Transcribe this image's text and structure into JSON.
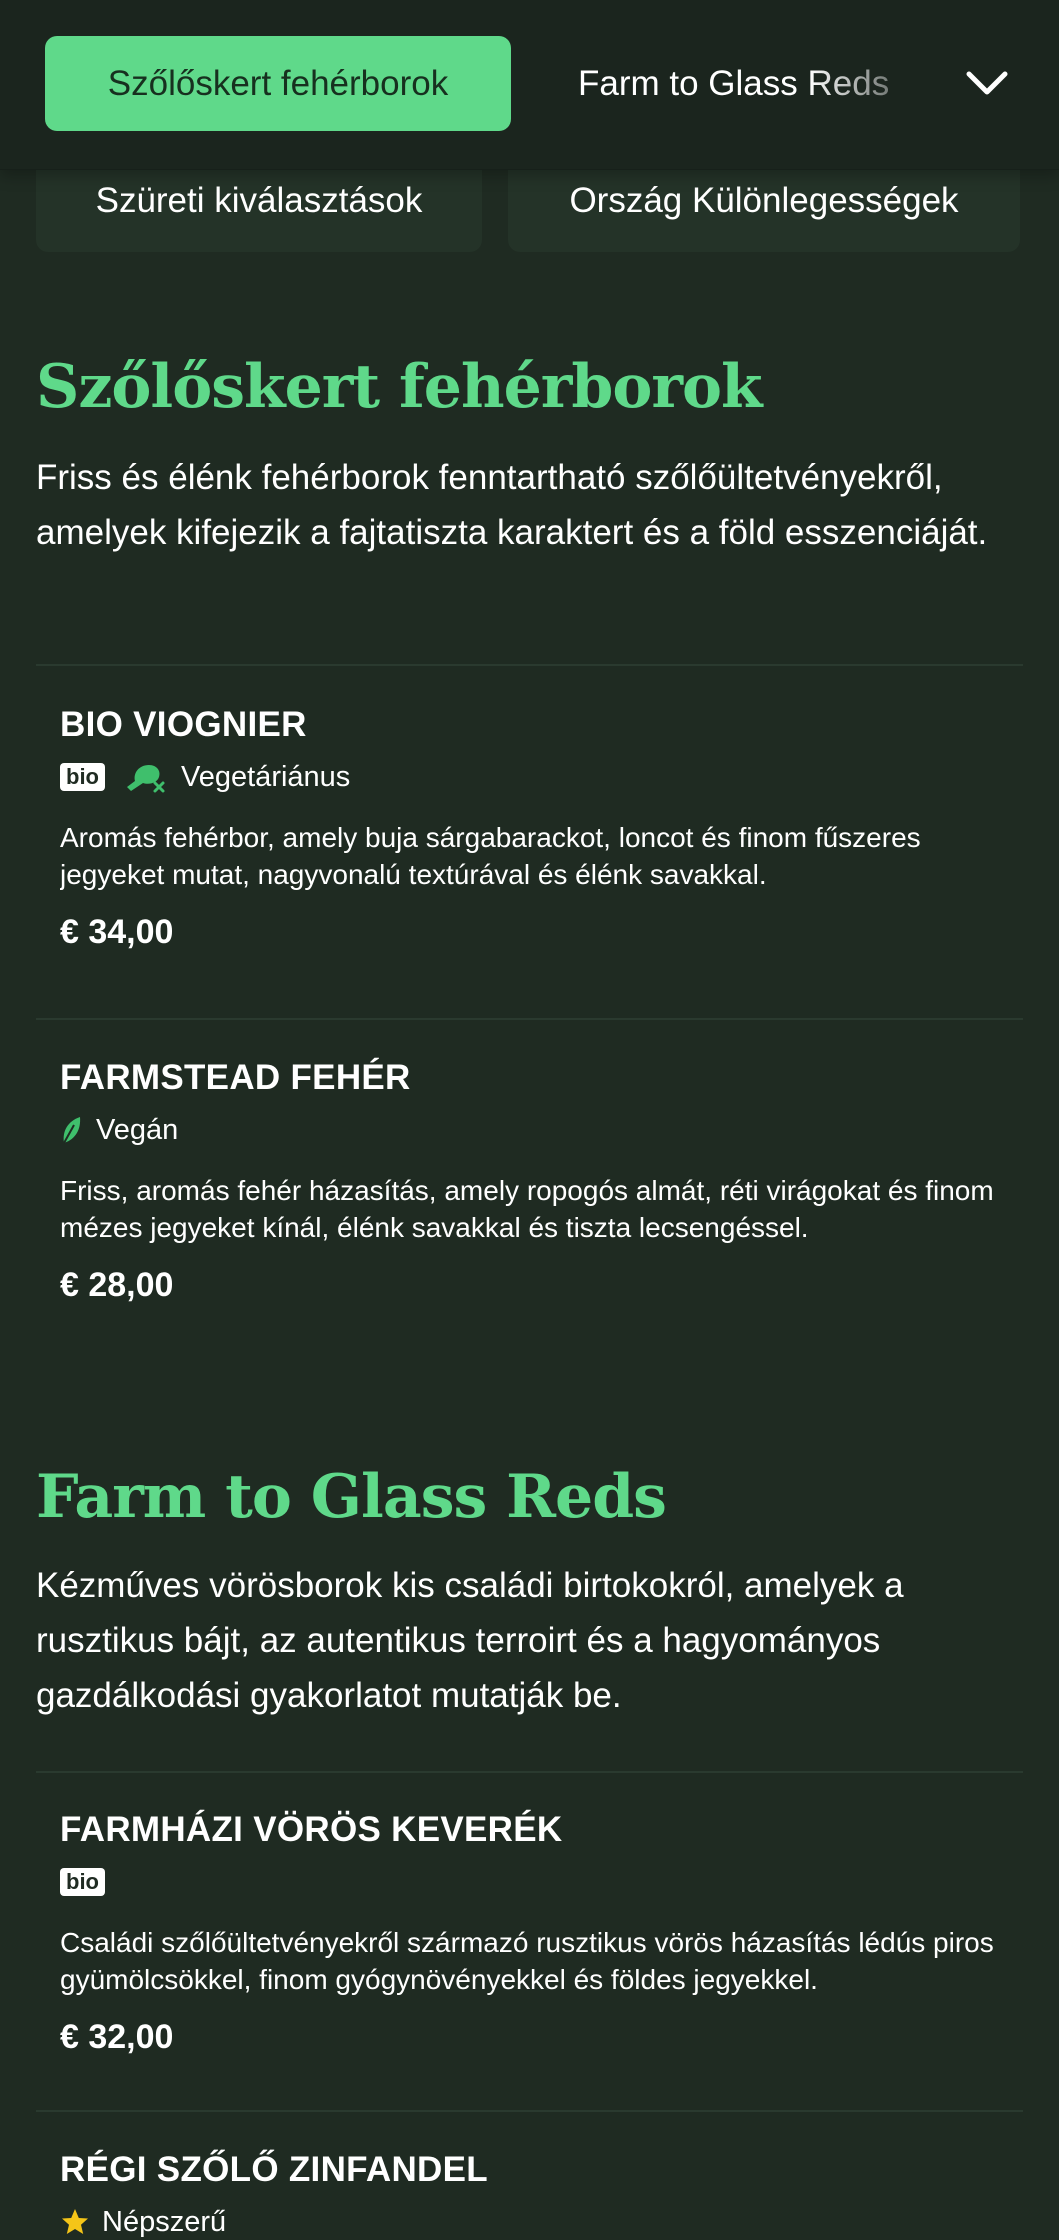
{
  "nav": {
    "active_tab": "Szőlőskert fehérborok",
    "tab_2": "Farm to Glass Reds",
    "chips": [
      "Szüreti kiválasztások",
      "Ország Különlegességek"
    ]
  },
  "sections": [
    {
      "title": "Szőlőskert fehérborok",
      "description": "Friss és élénk fehérborok fenntartható szőlőültetvényekről, amelyek kifejezik a fajtatiszta karaktert és a föld esszenciáját.",
      "items": [
        {
          "name": "BIO VIOGNIER",
          "badge": "bio",
          "tag": "Vegetáriánus",
          "description": "Aromás fehérbor, amely buja sárgabarackot, loncot és finom fűszeres jegyeket mutat, nagyvonalú textúrával és élénk savakkal.",
          "price": "€ 34,00"
        },
        {
          "name": "FARMSTEAD FEHÉR",
          "tag": "Vegán",
          "description": "Friss, aromás fehér házasítás, amely ropogós almát, réti virágokat és finom mézes jegyeket kínál, élénk savakkal és tiszta lecsengéssel.",
          "price": "€ 28,00"
        }
      ]
    },
    {
      "title": "Farm to Glass Reds",
      "description": "Kézműves vörösborok kis családi birtokokról, amelyek a rusztikus bájt, az autentikus terroirt és a hagyományos gazdálkodási gyakorlatot mutatják be.",
      "items": [
        {
          "name": "FARMHÁZI VÖRÖS KEVERÉK",
          "badge": "bio",
          "description": "Családi szőlőültetvényekről származó rusztikus vörös házasítás lédús piros gyümölcsökkel, finom gyógynövényekkel és földes jegyekkel.",
          "price": "€ 32,00"
        },
        {
          "name": "RÉGI SZŐLŐ ZINFANDEL",
          "tag": "Népszerű"
        }
      ]
    }
  ],
  "colors": {
    "accent": "#5fd98a",
    "background": "#1f2b22",
    "topbar": "#1b251e",
    "chip": "#243328",
    "star": "#f5c518"
  }
}
